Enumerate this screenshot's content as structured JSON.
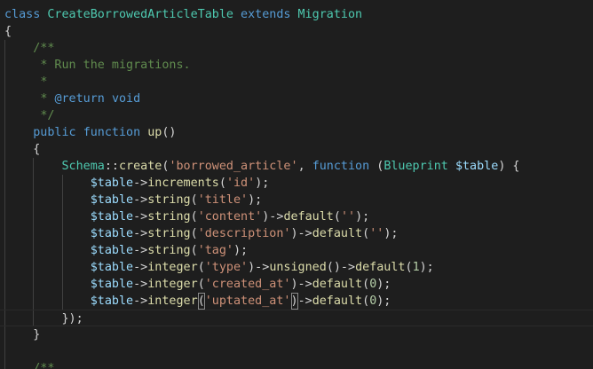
{
  "colors": {
    "background": "#1e1e1e",
    "keyword": "#569cd6",
    "class": "#4ec9b0",
    "function": "#dcdcaa",
    "string": "#ce9178",
    "variable": "#9cdcfe",
    "comment": "#608b4e",
    "number": "#b5cea8",
    "punctuation": "#d4d4d4"
  },
  "editor": {
    "current_line": 18,
    "lines": [
      [
        [
          "kw",
          "class"
        ],
        [
          "pun",
          " "
        ],
        [
          "cls",
          "CreateBorrowedArticleTable"
        ],
        [
          "pun",
          " "
        ],
        [
          "kw",
          "extends"
        ],
        [
          "pun",
          " "
        ],
        [
          "cls",
          "Migration"
        ]
      ],
      [
        [
          "pun",
          "{"
        ]
      ],
      [
        [
          "pun",
          "    "
        ],
        [
          "cmt",
          "/**"
        ]
      ],
      [
        [
          "pun",
          "     "
        ],
        [
          "cmt",
          "* Run the migrations."
        ]
      ],
      [
        [
          "pun",
          "     "
        ],
        [
          "cmt",
          "*"
        ]
      ],
      [
        [
          "pun",
          "     "
        ],
        [
          "cmt",
          "* "
        ],
        [
          "kw",
          "@return"
        ],
        [
          "pun",
          " "
        ],
        [
          "kw",
          "void"
        ]
      ],
      [
        [
          "pun",
          "     "
        ],
        [
          "cmt",
          "*/"
        ]
      ],
      [
        [
          "pun",
          "    "
        ],
        [
          "kw",
          "public"
        ],
        [
          "pun",
          " "
        ],
        [
          "kw",
          "function"
        ],
        [
          "pun",
          " "
        ],
        [
          "fn",
          "up"
        ],
        [
          "pun",
          "()"
        ]
      ],
      [
        [
          "pun",
          "    {"
        ]
      ],
      [
        [
          "pun",
          "        "
        ],
        [
          "cls",
          "Schema"
        ],
        [
          "pun",
          "::"
        ],
        [
          "fn",
          "create"
        ],
        [
          "pun",
          "("
        ],
        [
          "str",
          "'borrowed_article'"
        ],
        [
          "pun",
          ", "
        ],
        [
          "kw",
          "function"
        ],
        [
          "pun",
          " ("
        ],
        [
          "cls",
          "Blueprint"
        ],
        [
          "pun",
          " "
        ],
        [
          "var",
          "$table"
        ],
        [
          "pun",
          ") {"
        ]
      ],
      [
        [
          "pun",
          "            "
        ],
        [
          "var",
          "$table"
        ],
        [
          "pun",
          "->"
        ],
        [
          "fn",
          "increments"
        ],
        [
          "pun",
          "("
        ],
        [
          "str",
          "'id'"
        ],
        [
          "pun",
          ");"
        ]
      ],
      [
        [
          "pun",
          "            "
        ],
        [
          "var",
          "$table"
        ],
        [
          "pun",
          "->"
        ],
        [
          "fn",
          "string"
        ],
        [
          "pun",
          "("
        ],
        [
          "str",
          "'title'"
        ],
        [
          "pun",
          ");"
        ]
      ],
      [
        [
          "pun",
          "            "
        ],
        [
          "var",
          "$table"
        ],
        [
          "pun",
          "->"
        ],
        [
          "fn",
          "string"
        ],
        [
          "pun",
          "("
        ],
        [
          "str",
          "'content'"
        ],
        [
          "pun",
          ")->"
        ],
        [
          "fn",
          "default"
        ],
        [
          "pun",
          "("
        ],
        [
          "str",
          "''"
        ],
        [
          "pun",
          ");"
        ]
      ],
      [
        [
          "pun",
          "            "
        ],
        [
          "var",
          "$table"
        ],
        [
          "pun",
          "->"
        ],
        [
          "fn",
          "string"
        ],
        [
          "pun",
          "("
        ],
        [
          "str",
          "'description'"
        ],
        [
          "pun",
          ")->"
        ],
        [
          "fn",
          "default"
        ],
        [
          "pun",
          "("
        ],
        [
          "str",
          "''"
        ],
        [
          "pun",
          ");"
        ]
      ],
      [
        [
          "pun",
          "            "
        ],
        [
          "var",
          "$table"
        ],
        [
          "pun",
          "->"
        ],
        [
          "fn",
          "string"
        ],
        [
          "pun",
          "("
        ],
        [
          "str",
          "'tag'"
        ],
        [
          "pun",
          ");"
        ]
      ],
      [
        [
          "pun",
          "            "
        ],
        [
          "var",
          "$table"
        ],
        [
          "pun",
          "->"
        ],
        [
          "fn",
          "integer"
        ],
        [
          "pun",
          "("
        ],
        [
          "str",
          "'type'"
        ],
        [
          "pun",
          ")->"
        ],
        [
          "fn",
          "unsigned"
        ],
        [
          "pun",
          "()->"
        ],
        [
          "fn",
          "default"
        ],
        [
          "pun",
          "("
        ],
        [
          "num",
          "1"
        ],
        [
          "pun",
          ");"
        ]
      ],
      [
        [
          "pun",
          "            "
        ],
        [
          "var",
          "$table"
        ],
        [
          "pun",
          "->"
        ],
        [
          "fn",
          "integer"
        ],
        [
          "pun",
          "("
        ],
        [
          "str",
          "'created_at'"
        ],
        [
          "pun",
          ")->"
        ],
        [
          "fn",
          "default"
        ],
        [
          "pun",
          "("
        ],
        [
          "num",
          "0"
        ],
        [
          "pun",
          ");"
        ]
      ],
      [
        [
          "pun",
          "            "
        ],
        [
          "var",
          "$table"
        ],
        [
          "pun",
          "->"
        ],
        [
          "fn",
          "integer"
        ],
        [
          "bm",
          "("
        ],
        [
          "str",
          "'uptated_at'"
        ],
        [
          "bm",
          ")"
        ],
        [
          "pun",
          "->"
        ],
        [
          "fn",
          "default"
        ],
        [
          "pun",
          "("
        ],
        [
          "num",
          "0"
        ],
        [
          "pun",
          ");"
        ]
      ],
      [
        [
          "pun",
          "        });"
        ]
      ],
      [
        [
          "pun",
          "    }"
        ]
      ],
      [
        [
          "pun",
          ""
        ]
      ],
      [
        [
          "pun",
          "    "
        ],
        [
          "cmt",
          "/**"
        ]
      ]
    ]
  }
}
